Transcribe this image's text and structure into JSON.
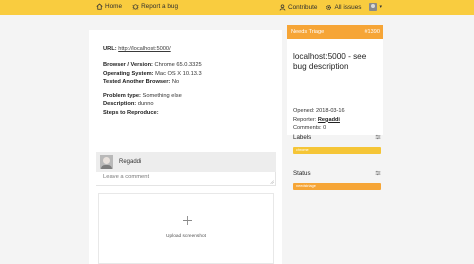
{
  "nav": {
    "home": "Home",
    "report": "Report a bug",
    "contribute": "Contribute",
    "all_issues": "All issues"
  },
  "report": {
    "url_label": "URL:",
    "url_value": "http://localhost:5000/",
    "browser_label": "Browser / Version:",
    "browser_value": "Chrome 65.0.3325",
    "os_label": "Operating System:",
    "os_value": "Mac OS X 10.13.3",
    "tested_label": "Tested Another Browser:",
    "tested_value": "No",
    "problem_label": "Problem type:",
    "problem_value": "Something else",
    "desc_label": "Description:",
    "desc_value": "dunno",
    "steps_label": "Steps to Reproduce:"
  },
  "comment": {
    "username": "Regaddi",
    "placeholder": "Leave a comment"
  },
  "upload": {
    "label": "Upload screenshot"
  },
  "sidebar": {
    "status_text": "Needs Triage",
    "issue_number": "#1390",
    "title": "localhost:5000 - see bug description",
    "opened": "Opened: 2018-03-16",
    "reporter_label": "Reporter:",
    "reporter_name": "Regaddi",
    "comments": "Comments: 0",
    "labels_title": "Labels",
    "label_tag": "chrome",
    "status_title": "Status",
    "status_tag": "needstriage"
  },
  "colors": {
    "topbar": "#f9cc3f",
    "triage": "#f6a536",
    "label_chrome": "#f5c536",
    "label_status": "#f6a536"
  },
  "icons": {
    "home": "home-icon",
    "report": "bug-icon",
    "contribute": "user-icon",
    "all_issues": "gear-icon"
  }
}
